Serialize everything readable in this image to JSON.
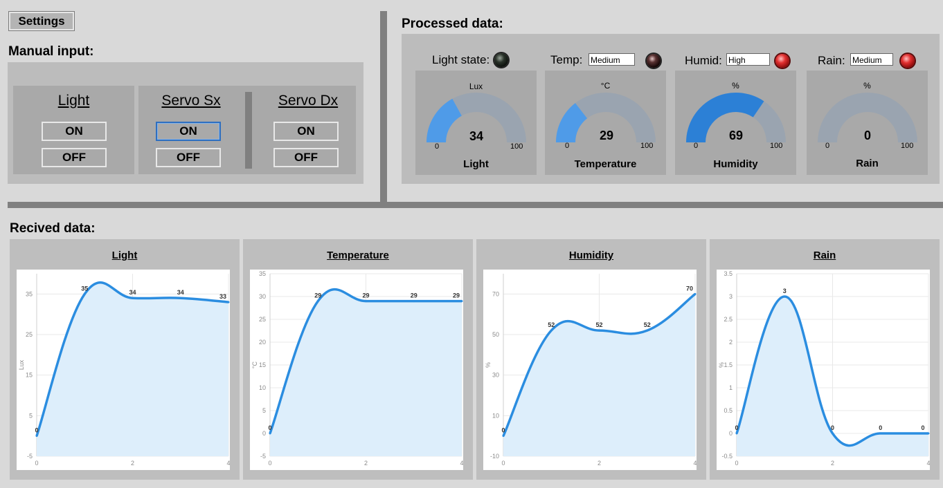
{
  "toolbar": {
    "settings_label": "Settings"
  },
  "manual_input": {
    "title": "Manual input:",
    "controls": [
      {
        "label": "Light",
        "on": "ON",
        "off": "OFF"
      },
      {
        "label": "Servo Sx",
        "on": "ON",
        "off": "OFF"
      },
      {
        "label": "Servo Dx",
        "on": "ON",
        "off": "OFF"
      }
    ]
  },
  "processed": {
    "title": "Processed data:",
    "light_state_label": "Light state:",
    "temp_label": "Temp:",
    "temp_value": "Medium",
    "humid_label": "Humid:",
    "humid_value": "High",
    "rain_label": "Rain:",
    "rain_value": "Medium",
    "gauges": [
      {
        "unit": "Lux",
        "value": "34",
        "min": "0",
        "max": "100",
        "name": "Light"
      },
      {
        "unit": "°C",
        "value": "29",
        "min": "0",
        "max": "100",
        "name": "Temperature"
      },
      {
        "unit": "%",
        "value": "69",
        "min": "0",
        "max": "100",
        "name": "Humidity"
      },
      {
        "unit": "%",
        "value": "0",
        "min": "0",
        "max": "100",
        "name": "Rain"
      }
    ],
    "colors": {
      "gauge_fill_light": "#4f9be8",
      "gauge_fill_dark": "#2c80d6",
      "gauge_track": "#9aa4b0"
    }
  },
  "received": {
    "title": "Recived data:",
    "chart_titles": [
      "Light",
      "Temperature",
      "Humidity",
      "Rain"
    ]
  },
  "chart_data": [
    {
      "type": "area",
      "title": "Light",
      "ylabel": "Lux",
      "x": [
        0,
        1,
        2,
        3,
        4
      ],
      "values": [
        0,
        35,
        34,
        34,
        33
      ],
      "yticks": [
        "35",
        "25",
        "15",
        "5",
        "-5"
      ],
      "xticks": [
        "0",
        "2",
        "4"
      ],
      "ylim": [
        -5,
        40
      ]
    },
    {
      "type": "area",
      "title": "Temperature",
      "ylabel": "°C",
      "x": [
        0,
        1,
        2,
        3,
        4
      ],
      "values": [
        0,
        29,
        29,
        29,
        29
      ],
      "yticks": [
        "35",
        "30",
        "25",
        "20",
        "15",
        "10",
        "5",
        "0",
        "-5"
      ],
      "xticks": [
        "0",
        "2",
        "4"
      ],
      "ylim": [
        -5,
        35
      ]
    },
    {
      "type": "area",
      "title": "Humidity",
      "ylabel": "%",
      "x": [
        0,
        1,
        2,
        3,
        4
      ],
      "values": [
        0,
        52,
        52,
        52,
        70
      ],
      "yticks": [
        "70",
        "50",
        "30",
        "10",
        "-10"
      ],
      "xticks": [
        "0",
        "2",
        "4"
      ],
      "ylim": [
        -10,
        80
      ]
    },
    {
      "type": "area",
      "title": "Rain",
      "ylabel": "%",
      "x": [
        0,
        1,
        2,
        3,
        4
      ],
      "values": [
        0,
        3,
        0,
        0,
        0
      ],
      "yticks": [
        "3.5",
        "3",
        "2.5",
        "2",
        "1.5",
        "1",
        "0.5",
        "0",
        "-0.5"
      ],
      "xticks": [
        "0",
        "2",
        "4"
      ],
      "ylim": [
        -0.5,
        3.5
      ]
    }
  ],
  "chart_colors": {
    "line": "#2b8de0",
    "fill": "#ddeefb",
    "grid": "#e8e8e8",
    "tick": "#8a8a8a"
  }
}
